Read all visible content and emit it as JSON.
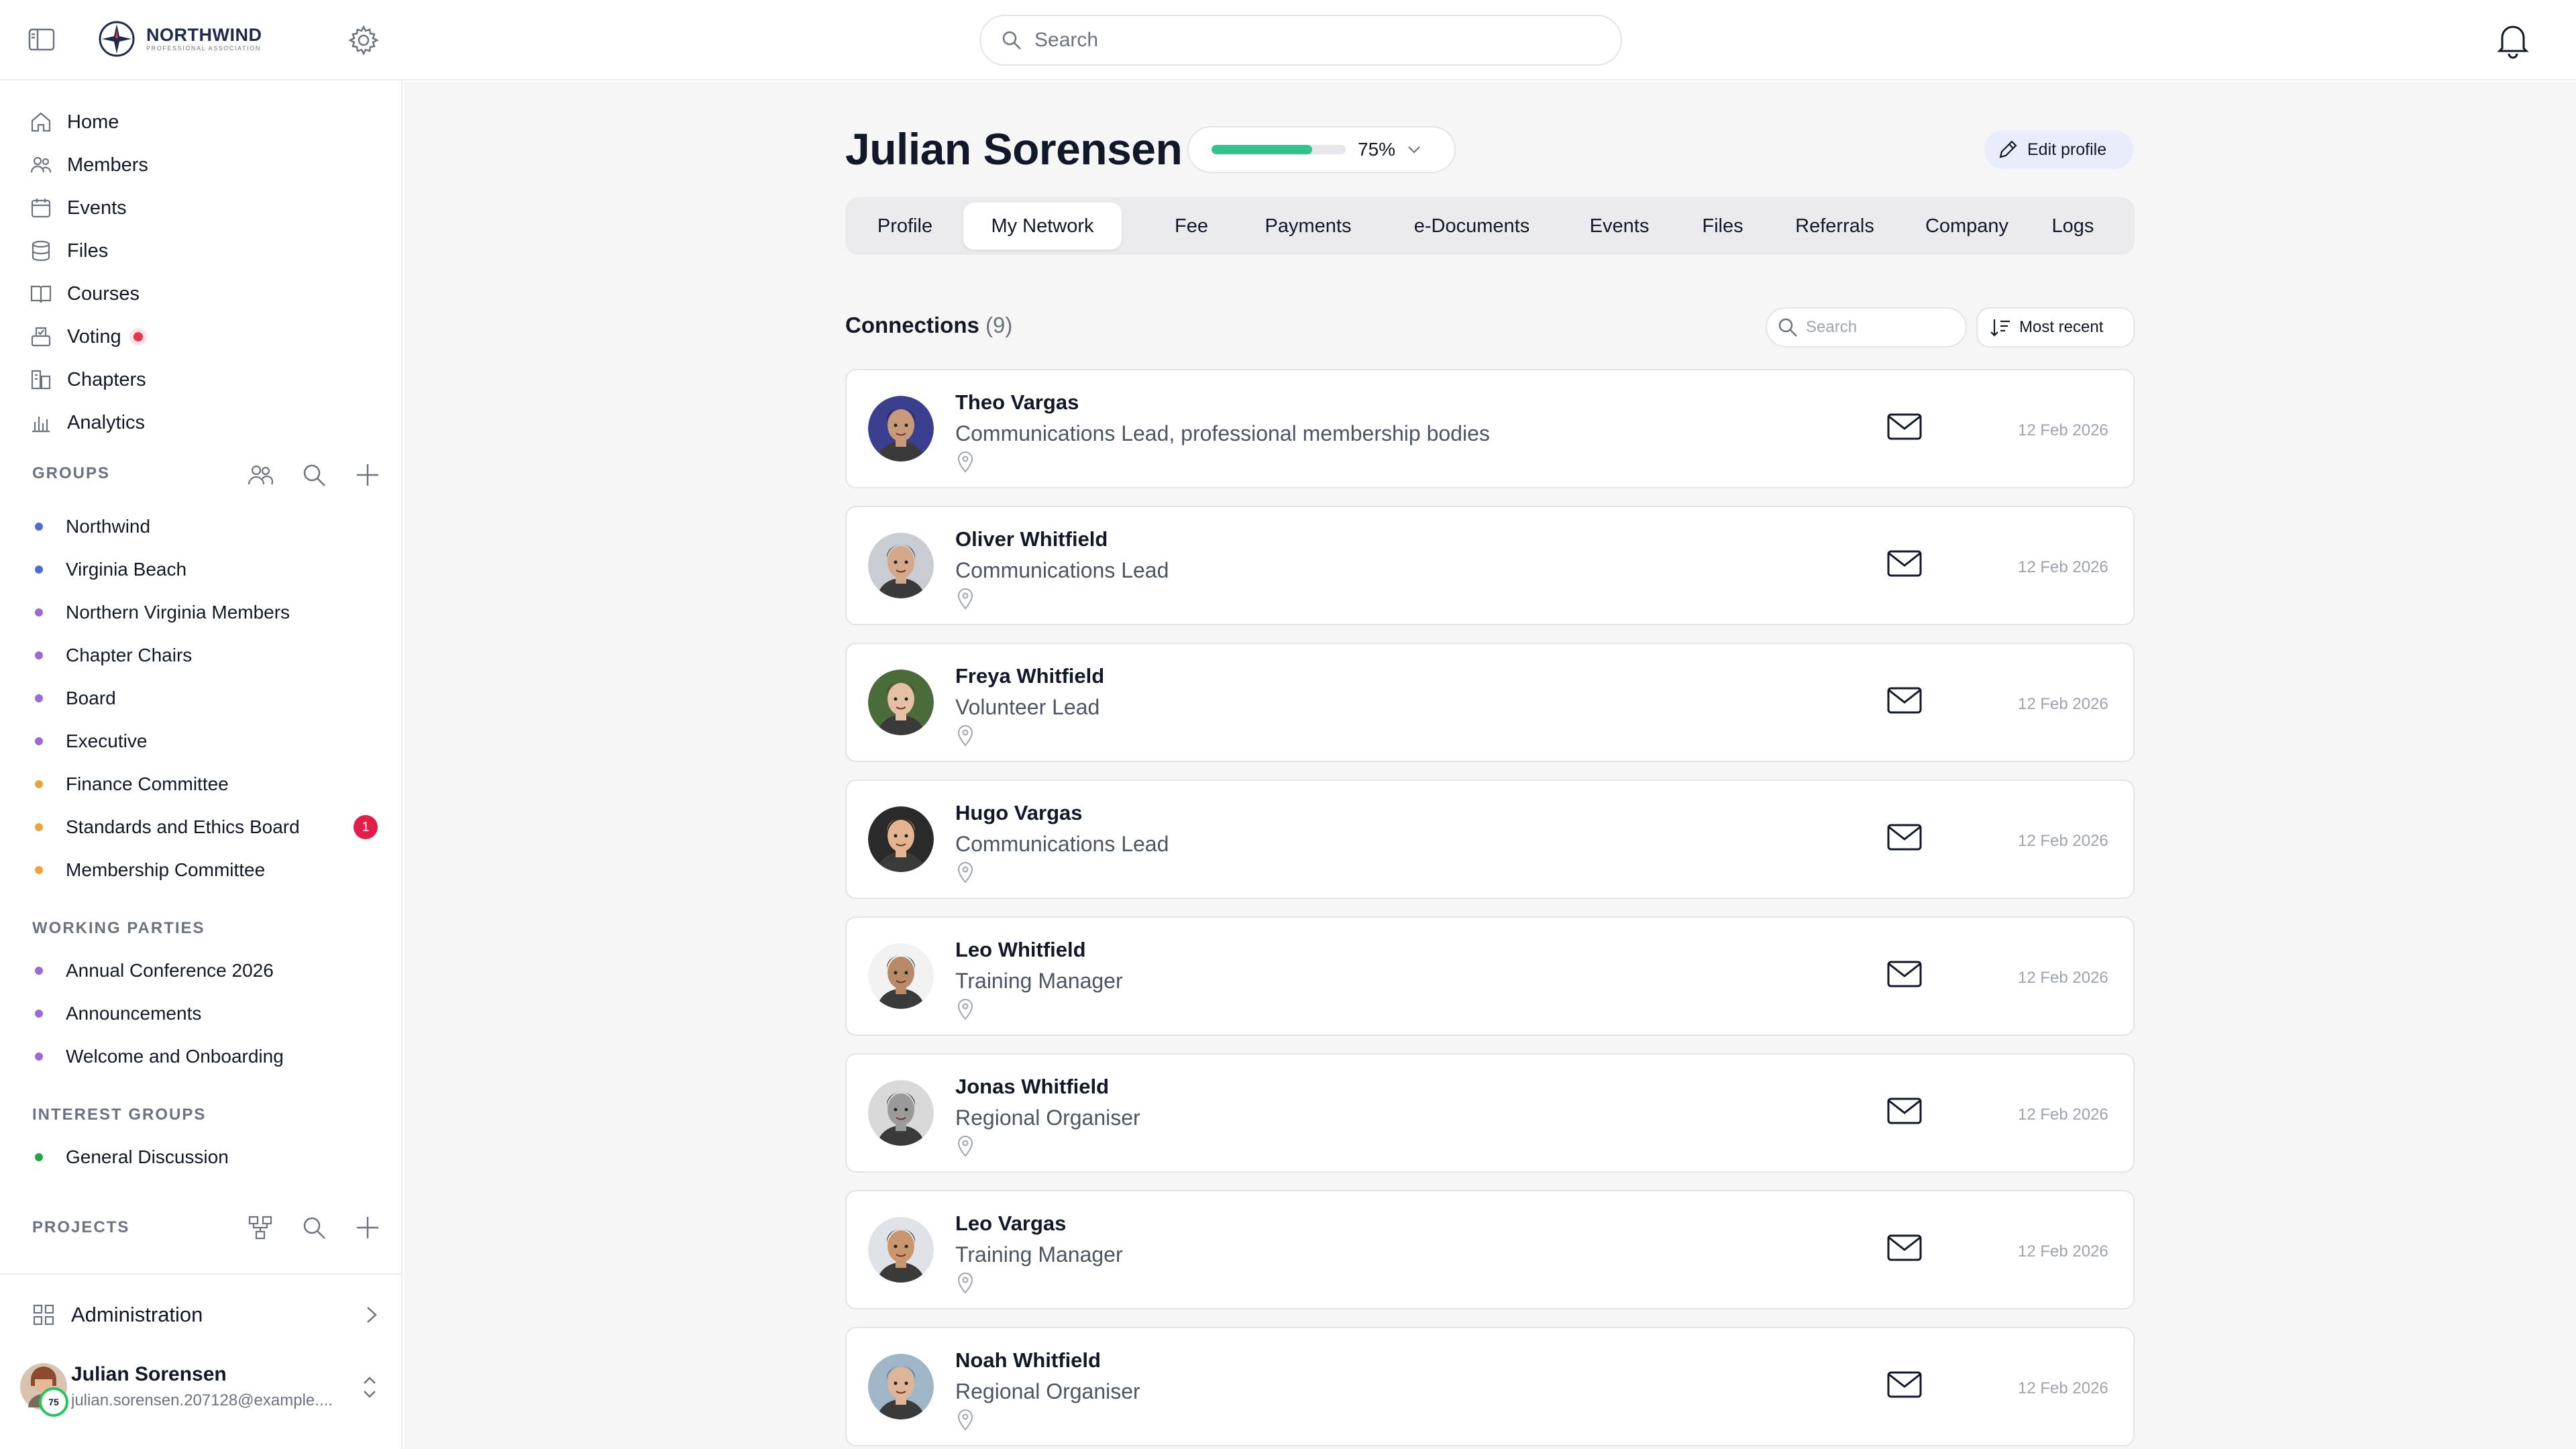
{
  "brand": {
    "name": "NORTHWIND",
    "subtitle": "PROFESSIONAL ASSOCIATION"
  },
  "search": {
    "placeholder": "Search"
  },
  "nav": [
    {
      "label": "Home",
      "icon": "home-icon"
    },
    {
      "label": "Members",
      "icon": "members-icon"
    },
    {
      "label": "Events",
      "icon": "calendar-icon"
    },
    {
      "label": "Files",
      "icon": "database-icon"
    },
    {
      "label": "Courses",
      "icon": "book-icon"
    },
    {
      "label": "Voting",
      "icon": "ballot-icon",
      "indicator": true
    },
    {
      "label": "Chapters",
      "icon": "chapters-icon"
    },
    {
      "label": "Analytics",
      "icon": "chart-icon"
    }
  ],
  "groups": {
    "heading": "GROUPS",
    "items": [
      {
        "label": "Northwind",
        "color": "#4f6bd8"
      },
      {
        "label": "Virginia Beach",
        "color": "#4f6bd8"
      },
      {
        "label": "Northern Virginia Members",
        "color": "#9b6ad6"
      },
      {
        "label": "Chapter Chairs",
        "color": "#9b6ad6"
      },
      {
        "label": "Board",
        "color": "#9b6ad6"
      },
      {
        "label": "Executive",
        "color": "#9b6ad6"
      },
      {
        "label": "Finance Committee",
        "color": "#f0a23a"
      },
      {
        "label": "Standards and Ethics Board",
        "color": "#f0a23a",
        "badge": "1"
      },
      {
        "label": "Membership Committee",
        "color": "#f0a23a"
      }
    ]
  },
  "working_parties": {
    "heading": "WORKING PARTIES",
    "items": [
      {
        "label": "Annual Conference 2026",
        "color": "#9b6ad6"
      },
      {
        "label": "Announcements",
        "color": "#9b6ad6"
      },
      {
        "label": "Welcome and Onboarding",
        "color": "#9b6ad6"
      }
    ]
  },
  "interest_groups": {
    "heading": "INTEREST GROUPS",
    "items": [
      {
        "label": "General Discussion",
        "color": "#22a34a"
      }
    ]
  },
  "projects": {
    "heading": "PROJECTS"
  },
  "admin": {
    "label": "Administration"
  },
  "user": {
    "name": "Julian Sorensen",
    "email": "julian.sorensen.207128@example....",
    "completion": "75"
  },
  "profile": {
    "name": "Julian Sorensen",
    "completion_pct": 75,
    "completion_label": "75%",
    "edit_label": "Edit profile"
  },
  "tabs": [
    {
      "label": "Profile"
    },
    {
      "label": "My Network",
      "active": true
    },
    {
      "label": "Fee"
    },
    {
      "label": "Payments"
    },
    {
      "label": "e-Documents"
    },
    {
      "label": "Events"
    },
    {
      "label": "Files"
    },
    {
      "label": "Referrals"
    },
    {
      "label": "Company"
    },
    {
      "label": "Logs"
    }
  ],
  "connections": {
    "title": "Connections",
    "count": "(9)",
    "search_placeholder": "Search",
    "sort_label": "Most recent",
    "items": [
      {
        "name": "Theo Vargas",
        "title": "Communications Lead, professional membership bodies",
        "date": "12 Feb 2026",
        "skin": "#c89a7a",
        "hair": "#2b1b12",
        "bg": "#3b3f8f"
      },
      {
        "name": "Oliver Whitfield",
        "title": "Communications Lead",
        "date": "12 Feb 2026",
        "skin": "#d4a88a",
        "hair": "#3a2a20",
        "bg": "#c9ccd1"
      },
      {
        "name": "Freya Whitfield",
        "title": "Volunteer Lead",
        "date": "12 Feb 2026",
        "skin": "#e6c0a4",
        "hair": "#5a3a24",
        "bg": "#4a6b3a"
      },
      {
        "name": "Hugo Vargas",
        "title": "Communications Lead",
        "date": "12 Feb 2026",
        "skin": "#e3b48f",
        "hair": "#b8893f",
        "bg": "#2a2a2a"
      },
      {
        "name": "Leo Whitfield",
        "title": "Training Manager",
        "date": "12 Feb 2026",
        "skin": "#b98a68",
        "hair": "#1c1c1c",
        "bg": "#f2f2f2"
      },
      {
        "name": "Jonas Whitfield",
        "title": "Regional Organiser",
        "date": "12 Feb 2026",
        "skin": "#9a9a9a",
        "hair": "#1a1a1a",
        "bg": "#d9d9d9"
      },
      {
        "name": "Leo Vargas",
        "title": "Training Manager",
        "date": "12 Feb 2026",
        "skin": "#c9966e",
        "hair": "#2a1a10",
        "bg": "#dfe3e8"
      },
      {
        "name": "Noah Whitfield",
        "title": "Regional Organiser",
        "date": "12 Feb 2026",
        "skin": "#ddb597",
        "hair": "#6b5544",
        "bg": "#9fb6c8"
      }
    ]
  },
  "colors": {
    "accent": "#34c38f",
    "badge": "#e11d48",
    "edit_bg": "#e8ecfb"
  }
}
